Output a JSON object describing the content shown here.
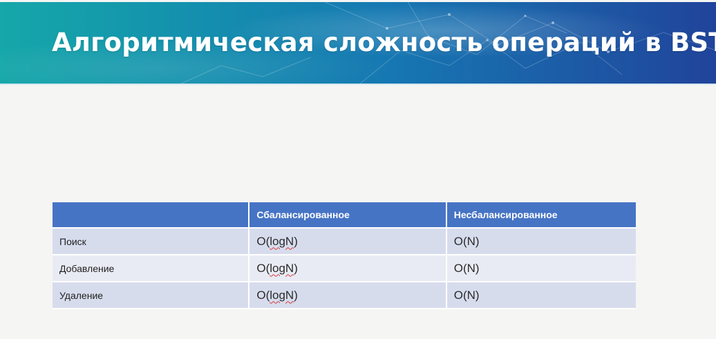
{
  "slide": {
    "title": "Алгоритмическая сложность операций в BST"
  },
  "table": {
    "headers": [
      "",
      "Сбалансированное",
      "Несбалансированное"
    ],
    "rows": [
      {
        "operation": "Поиск",
        "balanced_prefix": "O(",
        "balanced_core": "logN",
        "balanced_suffix": ")",
        "unbalanced": "O(N)"
      },
      {
        "operation": "Добавление",
        "balanced_prefix": "O(",
        "balanced_core": "logN",
        "balanced_suffix": ")",
        "unbalanced": "O(N)"
      },
      {
        "operation": "Удаление",
        "balanced_prefix": "O(",
        "balanced_core": "logN",
        "balanced_suffix": ")",
        "unbalanced": "O(N)"
      }
    ]
  },
  "colors": {
    "header_bg": "#4674c4",
    "row_bg_1": "#d7dced",
    "row_bg_2": "#e9ebf4",
    "title_color": "#ffffff",
    "spellcheck_underline": "#d83a3a"
  }
}
